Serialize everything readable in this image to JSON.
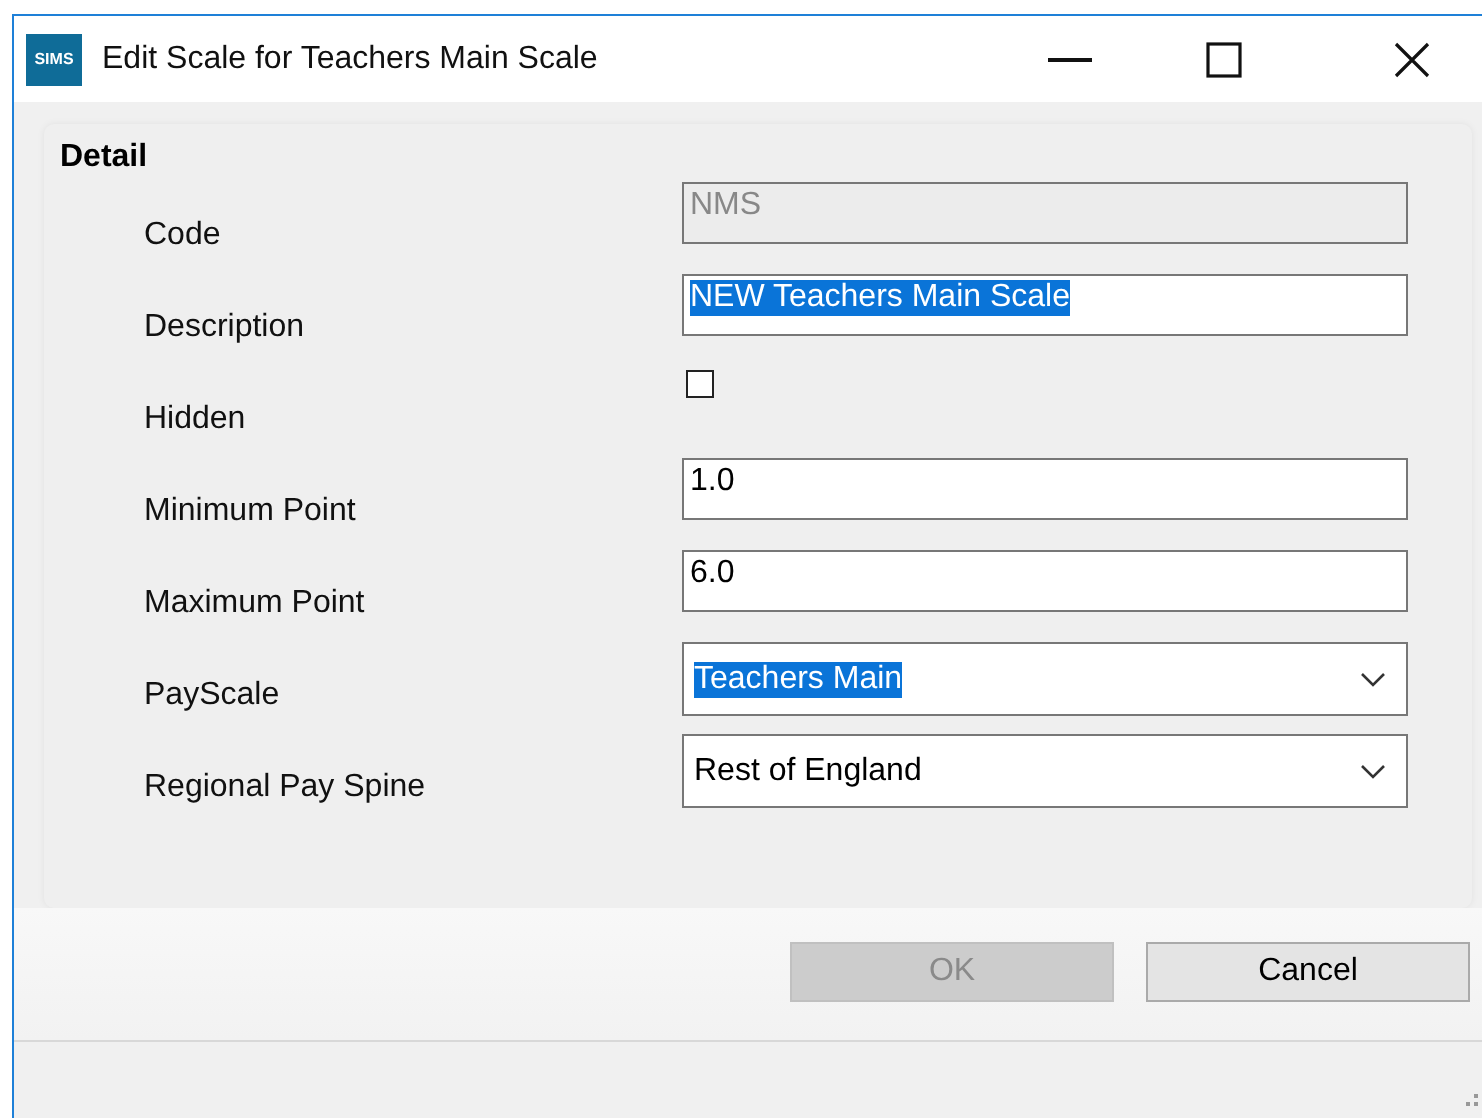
{
  "window": {
    "logo": "SIMS",
    "title": "Edit Scale for Teachers Main Scale"
  },
  "detail": {
    "heading": "Detail",
    "fields": [
      {
        "kind": "text",
        "label": "Code",
        "value": "NMS",
        "disabled": true,
        "highlighted": false
      },
      {
        "kind": "text",
        "label": "Description",
        "value": "NEW Teachers Main Scale",
        "disabled": false,
        "highlighted": true
      },
      {
        "kind": "checkbox",
        "label": "Hidden",
        "checked": false
      },
      {
        "kind": "text",
        "label": "Minimum Point",
        "value": "1.0",
        "disabled": false,
        "highlighted": false
      },
      {
        "kind": "text",
        "label": "Maximum Point",
        "value": "6.0",
        "disabled": false,
        "highlighted": false
      },
      {
        "kind": "dropdown",
        "label": "PayScale",
        "value": "Teachers Main",
        "highlighted": true
      },
      {
        "kind": "dropdown",
        "label": "Regional Pay Spine",
        "value": "Rest of England",
        "highlighted": false
      }
    ]
  },
  "buttons": [
    {
      "label": "OK",
      "disabled": true
    },
    {
      "label": "Cancel",
      "disabled": false
    }
  ]
}
